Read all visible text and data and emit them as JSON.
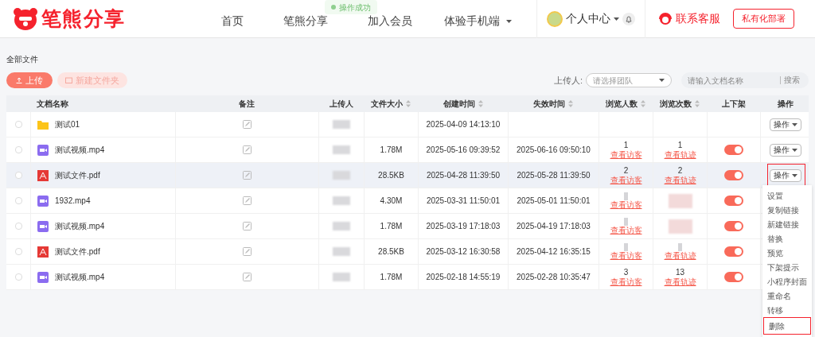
{
  "header": {
    "logo": "笔熊分享",
    "nav": [
      {
        "label": "首页",
        "dropdown": false
      },
      {
        "label": "笔熊分享",
        "dropdown": false
      },
      {
        "label": "加入会员",
        "dropdown": false
      },
      {
        "label": "体验手机端",
        "dropdown": true
      }
    ],
    "user": "个人中心",
    "service": "联系客服",
    "private_deploy": "私有化部署"
  },
  "toast": "操作成功",
  "breadcrumb": "全部文件",
  "actions": {
    "upload": "上传",
    "new_folder": "新建文件夹"
  },
  "filters": {
    "uploader_label": "上传人:",
    "uploader_placeholder": "请选择团队",
    "search_placeholder": "请输入文档名称",
    "search_button": "搜索"
  },
  "table": {
    "columns": [
      {
        "label": "文档名称",
        "sortable": false
      },
      {
        "label": "备注",
        "sortable": false
      },
      {
        "label": "上传人",
        "sortable": false
      },
      {
        "label": "文件大小",
        "sortable": true
      },
      {
        "label": "创建时间",
        "sortable": true
      },
      {
        "label": "失效时间",
        "sortable": true
      },
      {
        "label": "浏览人数",
        "sortable": true
      },
      {
        "label": "浏览次数",
        "sortable": true
      },
      {
        "label": "上下架",
        "sortable": false
      },
      {
        "label": "操作",
        "sortable": false
      }
    ],
    "rows": [
      {
        "kind": "folder",
        "name": "测试01",
        "checked": false,
        "selected": false,
        "created": "2025-04-09 14:13:10",
        "op": "操作"
      },
      {
        "kind": "video",
        "name": "测试视频.mp4",
        "checked": false,
        "selected": false,
        "size": "1.78M",
        "created": "2025-05-16 09:39:52",
        "expires": "2025-06-16 09:50:10",
        "viewers": "1",
        "viewers_link": "查看访客",
        "views": "1",
        "views_link": "查看轨迹",
        "on": true,
        "op": "操作"
      },
      {
        "kind": "pdf",
        "name": "测试文件.pdf",
        "checked": false,
        "selected": true,
        "size": "28.5KB",
        "created": "2025-04-28 11:39:50",
        "expires": "2025-05-28 11:39:50",
        "viewers": "2",
        "viewers_link": "查看访客",
        "views": "2",
        "views_link": "查看轨迹",
        "on": true,
        "op": "操作"
      },
      {
        "kind": "video",
        "name": "1932.mp4",
        "checked": false,
        "selected": false,
        "size": "4.30M",
        "created": "2025-03-31 11:50:01",
        "expires": "2025-05-01 11:50:01",
        "viewers_link": "查看访客",
        "on": true
      },
      {
        "kind": "video",
        "name": "测试视频.mp4",
        "checked": false,
        "selected": false,
        "size": "1.78M",
        "created": "2025-03-19 17:18:03",
        "expires": "2025-04-19 17:18:03",
        "viewers_link": "查看访客",
        "on": true
      },
      {
        "kind": "pdf",
        "name": "测试文件.pdf",
        "checked": false,
        "selected": false,
        "size": "28.5KB",
        "created": "2025-03-12 16:30:58",
        "expires": "2025-04-12 16:35:15",
        "viewers_link": "查看访客",
        "views_link": "查看轨迹",
        "on": true
      },
      {
        "kind": "video",
        "name": "测试视频.mp4",
        "checked": false,
        "selected": false,
        "size": "1.78M",
        "created": "2025-02-18 14:55:19",
        "expires": "2025-02-28 10:35:47",
        "viewers": "3",
        "viewers_link": "查看访客",
        "views": "13",
        "views_link": "查看轨迹",
        "on": true
      }
    ]
  },
  "menu": [
    {
      "label": "设置",
      "highlighted": false
    },
    {
      "label": "复制链接",
      "highlighted": false
    },
    {
      "label": "新建链接",
      "highlighted": false
    },
    {
      "label": "替换",
      "highlighted": false
    },
    {
      "label": "预览",
      "highlighted": false
    },
    {
      "label": "下架提示",
      "highlighted": false
    },
    {
      "label": "小程序封面",
      "highlighted": false
    },
    {
      "label": "重命名",
      "highlighted": false
    },
    {
      "label": "转移",
      "highlighted": false
    },
    {
      "label": "删除",
      "highlighted": true
    }
  ]
}
